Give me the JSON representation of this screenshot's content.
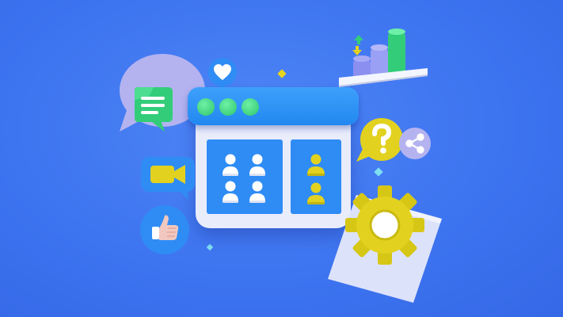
{
  "scene": {
    "background_color": "#3d74f0",
    "accent_blue": "#2f8cf5",
    "accent_green": "#34d07a",
    "accent_yellow": "#e2d21f",
    "accent_lavender": "#b9b7f3"
  },
  "window": {
    "title_dots": [
      "green",
      "green",
      "green"
    ],
    "left_panel_people": 4,
    "right_panel_people": 2
  },
  "icons": [
    "chat-bubble-icon",
    "heart-icon",
    "video-camera-icon",
    "thumbs-up-icon",
    "question-mark-icon",
    "share-icon",
    "gear-icon",
    "bar-chart-icon",
    "sort-arrows-icon",
    "document-icon"
  ],
  "bar_chart_levels": [
    0.45,
    0.7,
    1.0
  ]
}
